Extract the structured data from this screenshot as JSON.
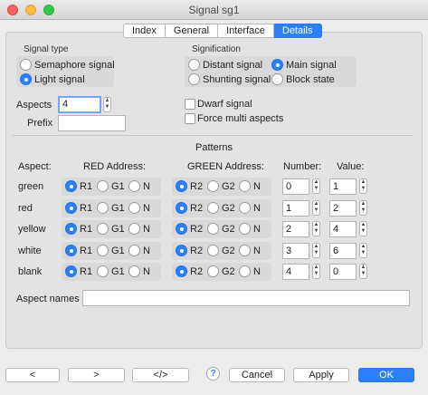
{
  "window": {
    "title": "Signal sg1"
  },
  "tabs": [
    {
      "label": "Index",
      "active": false
    },
    {
      "label": "General",
      "active": false
    },
    {
      "label": "Interface",
      "active": false
    },
    {
      "label": "Details",
      "active": true
    }
  ],
  "signal_type": {
    "heading": "Signal type",
    "options": [
      "Semaphore signal",
      "Light signal"
    ],
    "selected": "Light signal"
  },
  "signification": {
    "heading": "Signification",
    "options": [
      "Distant signal",
      "Main signal",
      "Shunting signal",
      "Block state"
    ],
    "selected": "Main signal"
  },
  "aspects": {
    "label": "Aspects",
    "value": "4"
  },
  "prefix": {
    "label": "Prefix",
    "value": ""
  },
  "dwarf_signal": {
    "label": "Dwarf signal",
    "checked": false
  },
  "force_multi_aspects": {
    "label": "Force multi aspects",
    "checked": false
  },
  "patterns": {
    "heading": "Patterns",
    "columns": {
      "aspect": "Aspect:",
      "red": "RED Address:",
      "green": "GREEN Address:",
      "number": "Number:",
      "value": "Value:"
    },
    "red_options": [
      "R1",
      "G1",
      "N"
    ],
    "green_options": [
      "R2",
      "G2",
      "N"
    ],
    "rows": [
      {
        "aspect": "green",
        "red": "R1",
        "green": "R2",
        "number": "0",
        "value": "1"
      },
      {
        "aspect": "red",
        "red": "R1",
        "green": "R2",
        "number": "1",
        "value": "2"
      },
      {
        "aspect": "yellow",
        "red": "R1",
        "green": "R2",
        "number": "2",
        "value": "4"
      },
      {
        "aspect": "white",
        "red": "R1",
        "green": "R2",
        "number": "3",
        "value": "6"
      },
      {
        "aspect": "blank",
        "red": "R1",
        "green": "R2",
        "number": "4",
        "value": "0"
      }
    ]
  },
  "aspect_names": {
    "label": "Aspect names",
    "value": ""
  },
  "buttons": {
    "prev": "<",
    "next": ">",
    "code": "</>",
    "help": "?",
    "cancel": "Cancel",
    "apply": "Apply",
    "ok": "OK"
  },
  "colors": {
    "accent": "#2d7ff9",
    "close": "#fc605b",
    "minimize": "#fdbc40",
    "maximize": "#34c84a"
  }
}
